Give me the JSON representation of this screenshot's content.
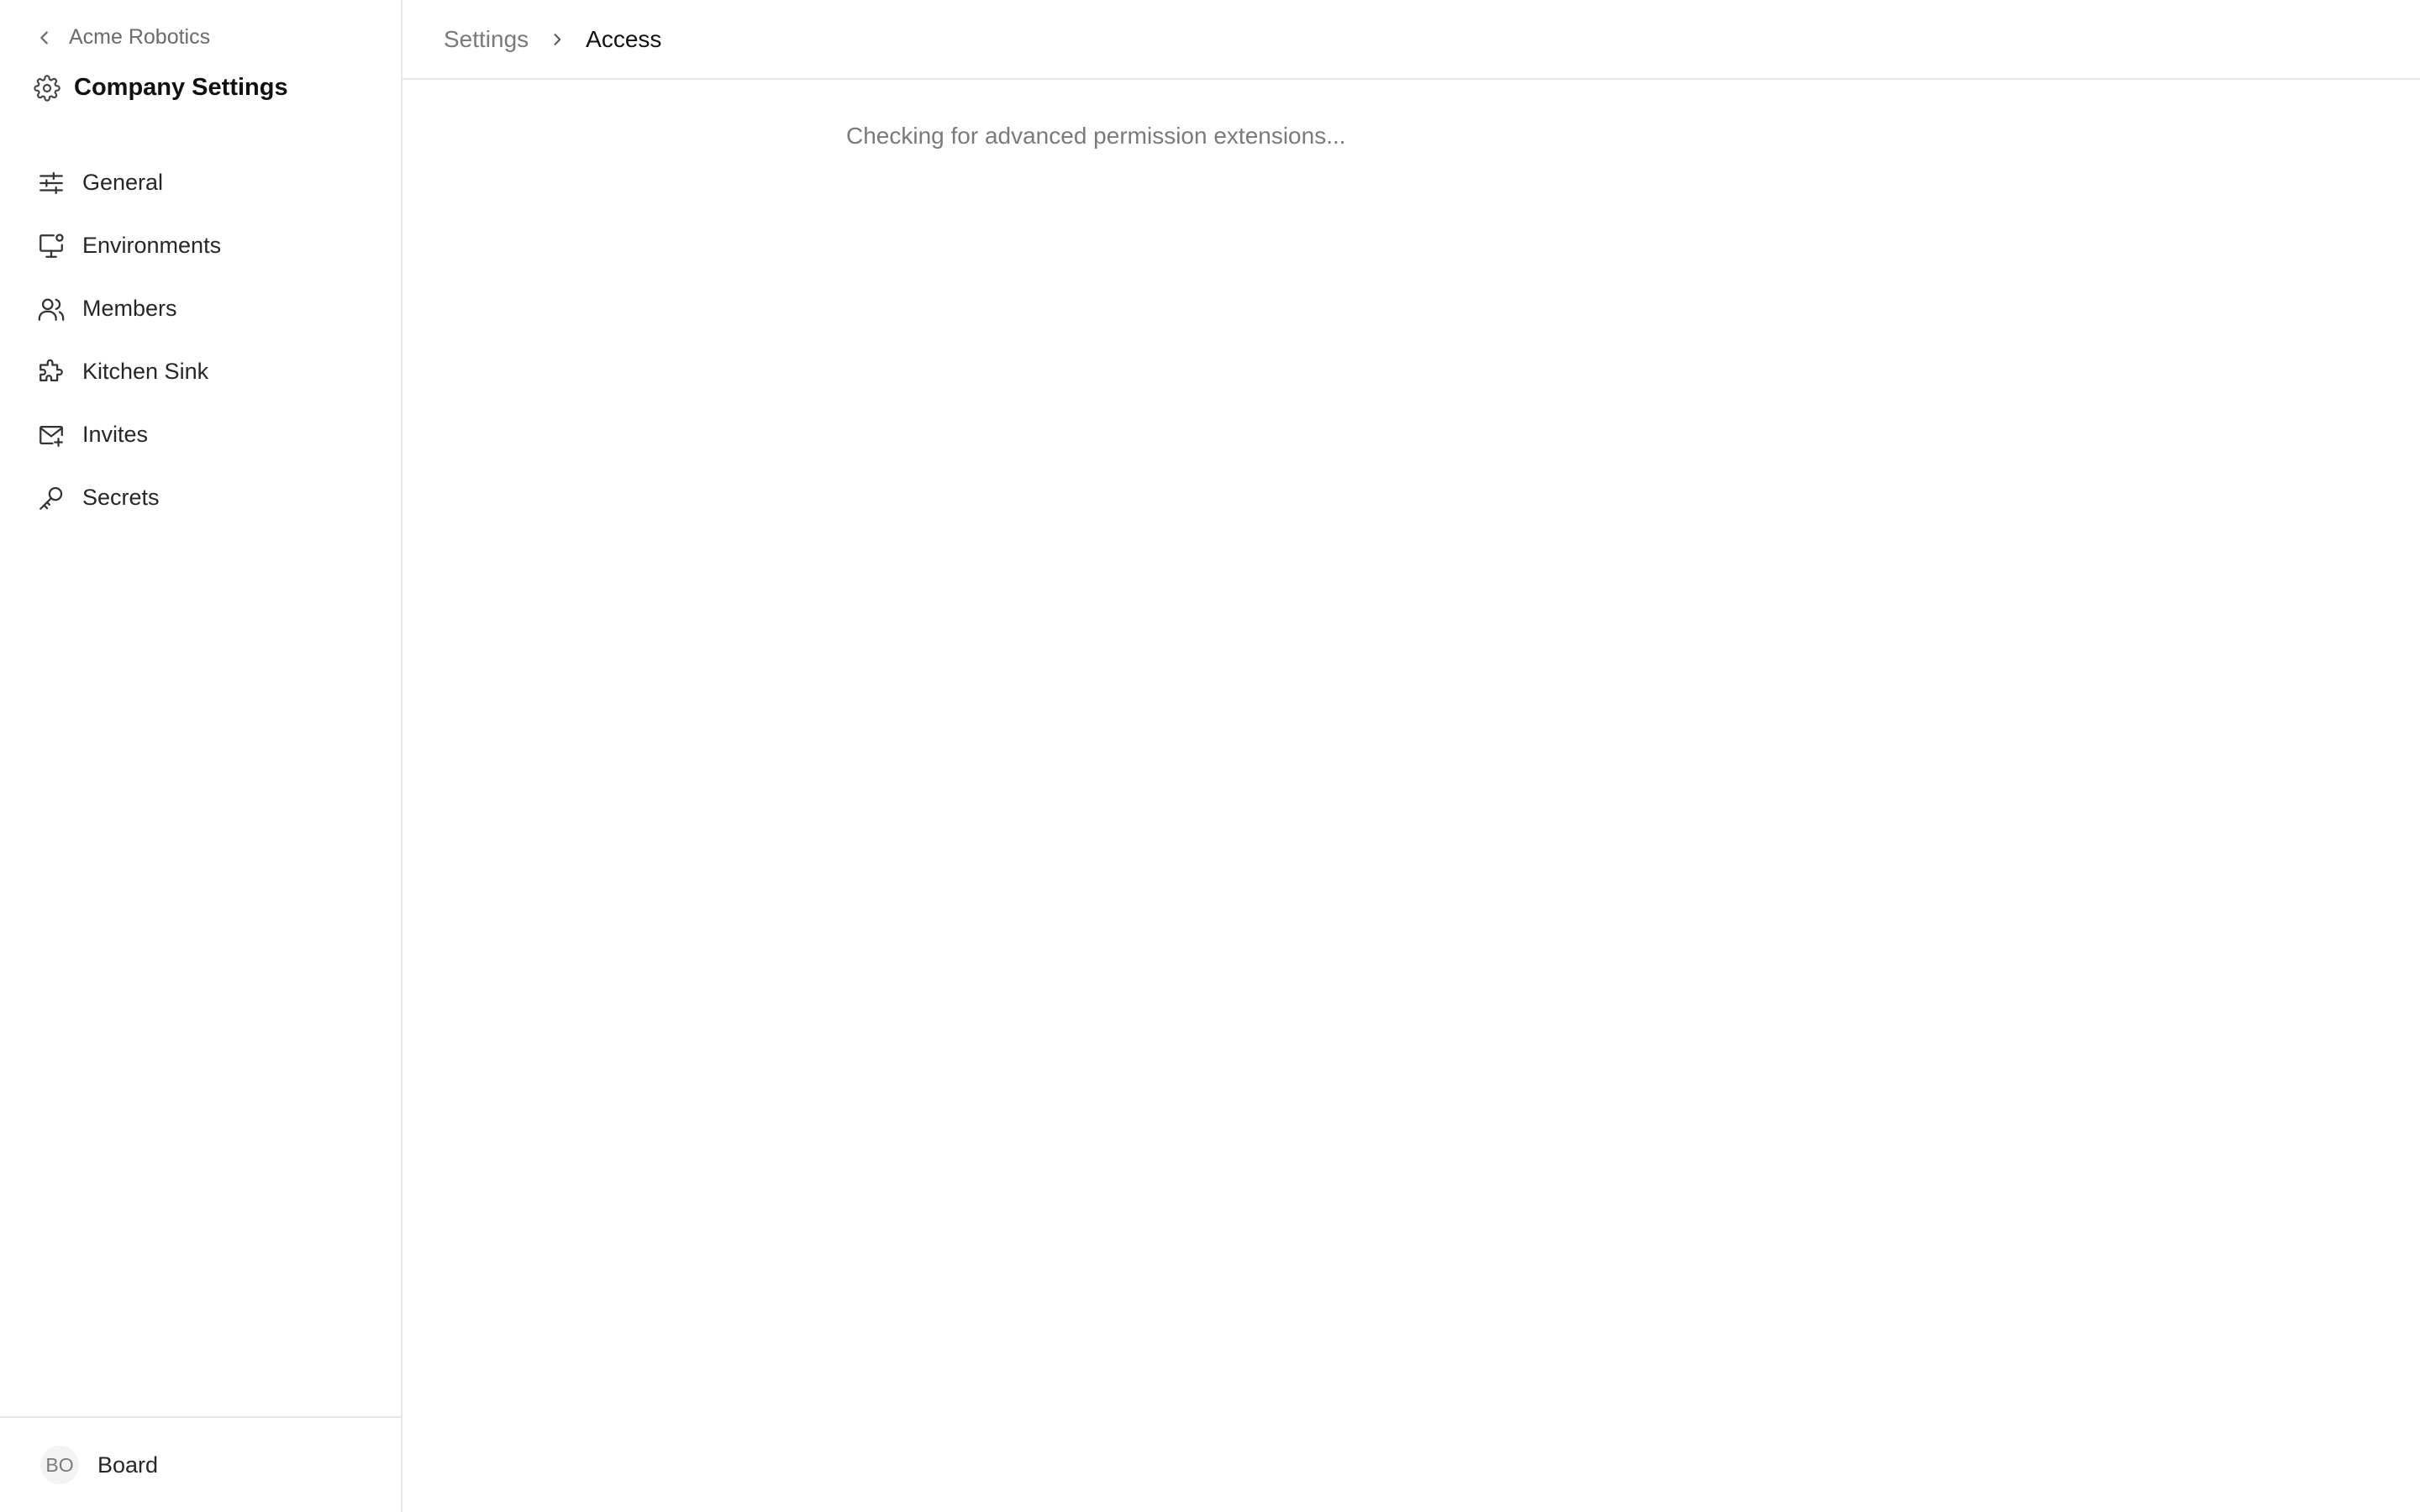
{
  "sidebar": {
    "back_label": "Acme Robotics",
    "title": "Company Settings",
    "items": [
      {
        "label": "General",
        "icon": "sliders-icon"
      },
      {
        "label": "Environments",
        "icon": "monitor-icon"
      },
      {
        "label": "Members",
        "icon": "users-icon"
      },
      {
        "label": "Kitchen Sink",
        "icon": "puzzle-icon"
      },
      {
        "label": "Invites",
        "icon": "mail-plus-icon"
      },
      {
        "label": "Secrets",
        "icon": "key-icon"
      }
    ],
    "footer": {
      "avatar_initials": "BO",
      "name": "Board"
    }
  },
  "breadcrumb": {
    "parent": "Settings",
    "current": "Access"
  },
  "main": {
    "status": "Checking for advanced permission extensions..."
  },
  "colors": {
    "border": "#e6e6e6",
    "muted_text": "#7a7a7a",
    "text": "#262626"
  }
}
